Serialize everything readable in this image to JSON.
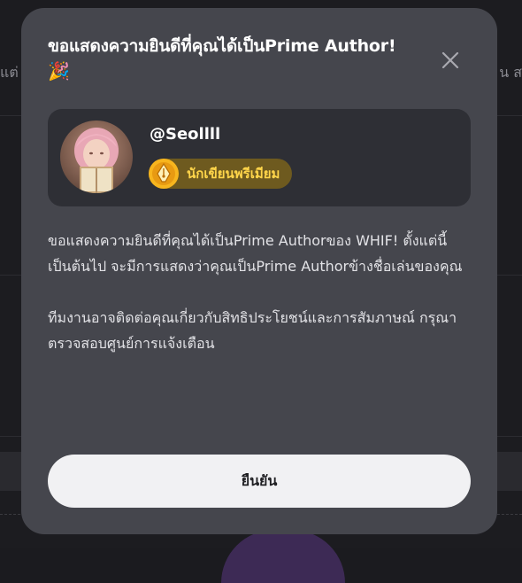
{
  "modal": {
    "title": "ขอแสดงความยินดีที่คุณได้เป็นPrime Author!",
    "title_emoji": "🎉",
    "profile": {
      "username": "@Seollll",
      "badge_label": "นักเขียนพรีเมียม"
    },
    "body": [
      "ขอแสดงความยินดีที่คุณได้เป็นPrime Authorของ WHIF! ตั้งแต่นี้เป็นต้นไป จะมีการแสดงว่าคุณเป็นPrime Authorข้างชื่อเล่นของคุณ",
      "ทีมงานอาจติดต่อคุณเกี่ยวกับสิทธิประโยชน์และการสัมภาษณ์ กรุณาตรวจสอบศูนย์การแจ้งเตือน"
    ],
    "confirm_label": "ยืนยัน"
  },
  "background": {
    "left_text": "แต่ ของวั",
    "right_text": "น ส"
  },
  "colors": {
    "modal_bg": "#45464d",
    "card_bg": "#2e2f35",
    "badge_bg": "#6e5a1f",
    "badge_text": "#ffd54a",
    "button_bg": "#f1f1f3"
  }
}
